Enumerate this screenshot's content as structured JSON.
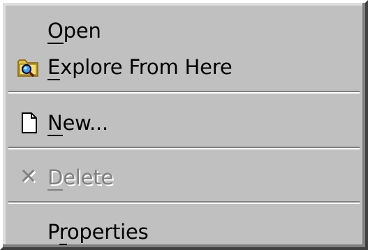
{
  "context_menu": {
    "items": [
      {
        "label_prefix": "",
        "label_mnemonic": "O",
        "label_rest": "pen",
        "icon": null,
        "enabled": true
      },
      {
        "label_prefix": "",
        "label_mnemonic": "E",
        "label_rest": "xplore From Here",
        "icon": "explore-folder-icon",
        "enabled": true
      },
      {
        "label_prefix": "",
        "label_mnemonic": "N",
        "label_rest": "ew...",
        "icon": "new-document-icon",
        "enabled": true
      },
      {
        "label_prefix": "",
        "label_mnemonic": "D",
        "label_rest": "elete",
        "icon": "delete-x-icon",
        "enabled": false
      },
      {
        "label_prefix": "P",
        "label_mnemonic": "r",
        "label_rest": "operties",
        "icon": null,
        "enabled": true
      }
    ],
    "delete_glyph": "✕",
    "colors": {
      "menu_face": "#c0c0c0",
      "disabled_text": "#808080",
      "highlight": "#ffffff",
      "shadow": "#808080"
    }
  }
}
